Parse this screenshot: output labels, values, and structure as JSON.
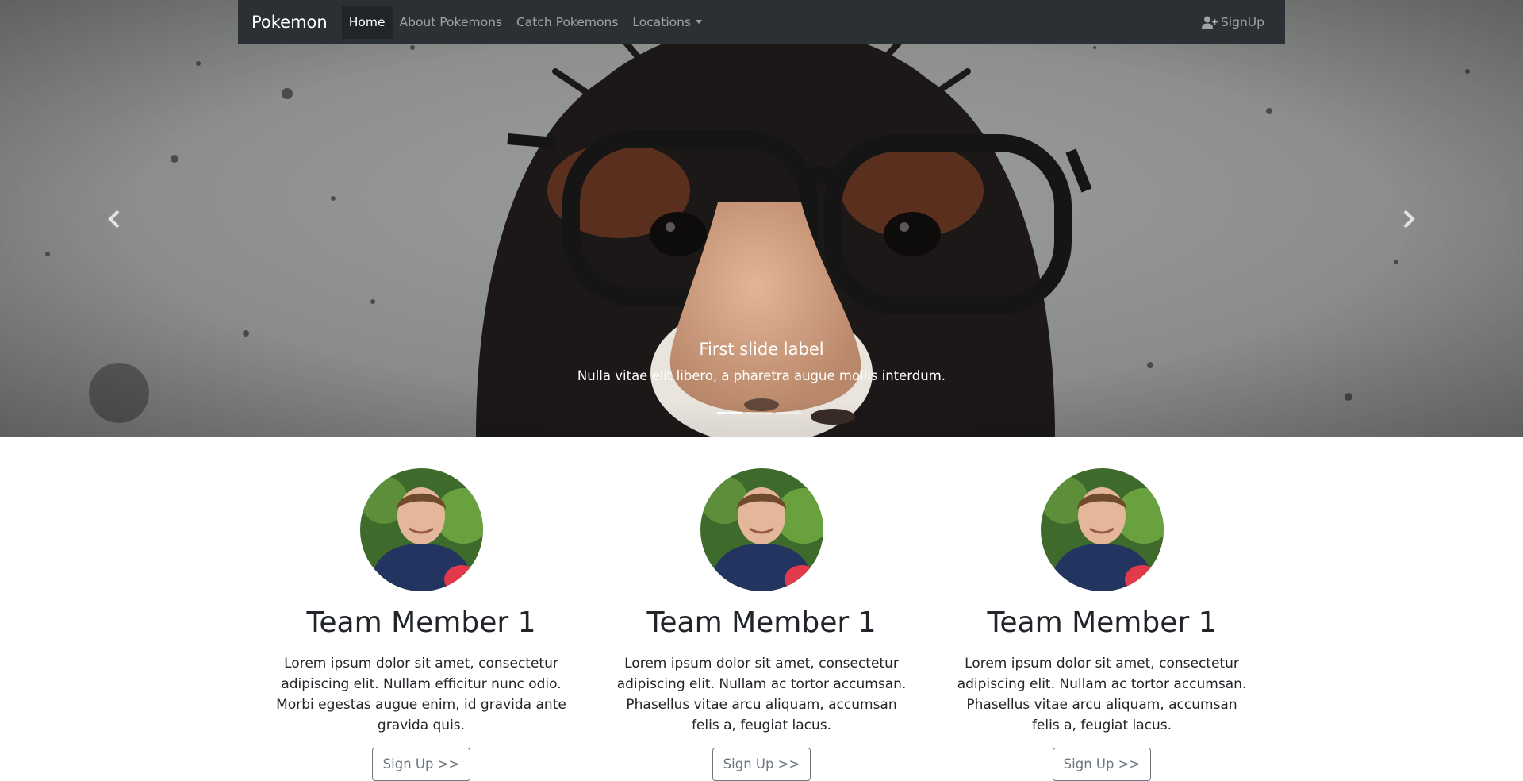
{
  "navbar": {
    "brand": "Pokemon",
    "links": [
      "Home",
      "About Pokemons",
      "Catch Pokemons",
      "Locations"
    ],
    "active_link": "Home",
    "signup_label": "SignUp"
  },
  "carousel": {
    "slide_title": "First slide label",
    "slide_text": "Nulla vitae elit libero, a pharetra augue mollis interdum.",
    "slide_count": 3,
    "active_slide": 1
  },
  "team": [
    {
      "name": "Team Member 1",
      "text": "Lorem ipsum dolor sit amet, consectetur adipiscing elit. Nullam efficitur nunc odio. Morbi egestas augue enim, id gravida ante gravida quis.",
      "button": "Sign Up >>"
    },
    {
      "name": "Team Member 1",
      "text": "Lorem ipsum dolor sit amet, consectetur adipiscing elit. Nullam ac tortor accumsan. Phasellus vitae arcu aliquam, accumsan felis a, feugiat lacus.",
      "button": "Sign Up >>"
    },
    {
      "name": "Team Member 1",
      "text": "Lorem ipsum dolor sit amet, consectetur adipiscing elit. Nullam ac tortor accumsan. Phasellus vitae arcu aliquam, accumsan felis a, feugiat lacus.",
      "button": "Sign Up >>"
    }
  ],
  "colors": {
    "navbar_bg": "#2b3035",
    "active_link_bg": "#212529",
    "button_outline": "#6c757d"
  },
  "icons": {
    "prev": "chevron-left-icon",
    "next": "chevron-right-icon",
    "signup": "user-plus-icon"
  }
}
